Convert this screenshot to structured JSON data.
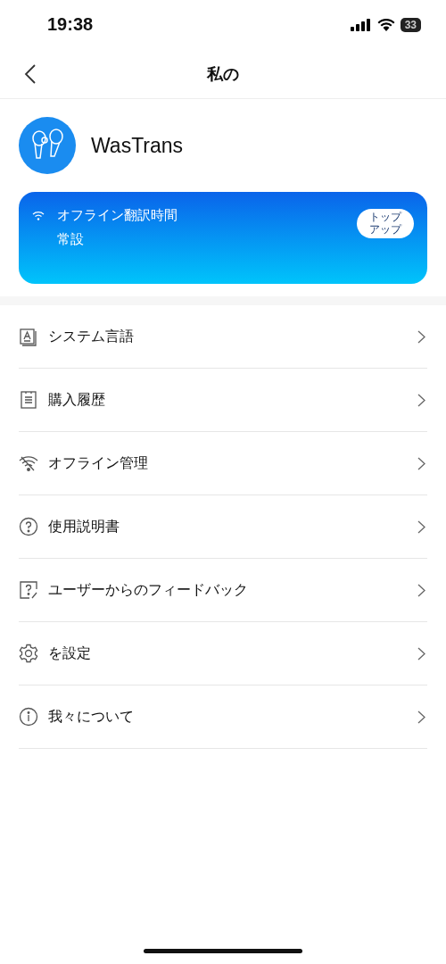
{
  "status_bar": {
    "time": "19:38",
    "battery": "33"
  },
  "nav": {
    "title": "私の"
  },
  "profile": {
    "name": "WasTrans"
  },
  "offline_card": {
    "title": "オフライン翻訳時間",
    "value": "常設",
    "button": "トップアップ"
  },
  "menu": [
    {
      "kind": "language",
      "label": "システム言語"
    },
    {
      "kind": "list",
      "label": "購入履歴"
    },
    {
      "kind": "wifi",
      "label": "オフライン管理"
    },
    {
      "kind": "help",
      "label": "使用説明書"
    },
    {
      "kind": "feedback",
      "label": "ユーザーからのフィードバック"
    },
    {
      "kind": "settings",
      "label": "を設定"
    },
    {
      "kind": "info",
      "label": "我々について"
    }
  ]
}
